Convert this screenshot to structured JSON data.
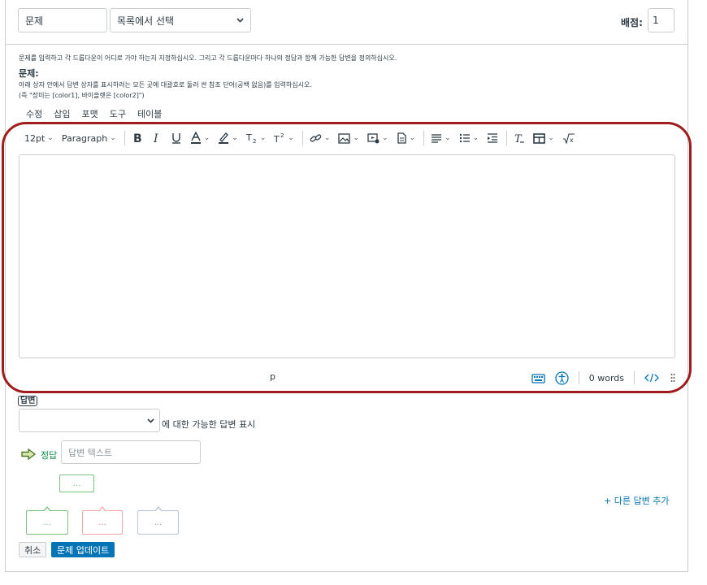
{
  "header": {
    "question_title": "문제",
    "question_type": "목록에서 선택",
    "points_label": "배점:",
    "points_value": "1"
  },
  "instructions": {
    "main": "문제를 입력하고 각 드롭다운이 어디로 가야 하는지 지정하십시오. 그리고 각 드롭다운마다 하나의 정답과 함께 가능한 답변을 정의하십시오.",
    "question_label": "문제:",
    "hint_line1": "아래 상자 안에서 답변 상자를 표시하려는 모든 곳에 대괄호로 둘러 싼 참조 단어(공백 없음)를 입력하십시오.",
    "hint_line2": "(즉 \"장미는 [color1], 바이올렛은 [color2]\")"
  },
  "editor": {
    "menu": [
      "수정",
      "삽입",
      "포맷",
      "도구",
      "테이블"
    ],
    "font_size": "12pt",
    "block_format": "Paragraph",
    "status_path": "p",
    "word_count": "0 words",
    "highlight_color": "#a01c1c"
  },
  "answers": {
    "label": "답변",
    "show_for_label": "에 대한 가능한 답변 표시",
    "correct_label": "정답",
    "answer_placeholder": "답변 텍스트",
    "ellipsis": "...",
    "add_answer": "+ 다른 답변 추가"
  },
  "buttons": {
    "cancel": "취소",
    "update": "문제 업데이트"
  },
  "colors": {
    "accent": "#0374b5",
    "correct": "#0b874b"
  }
}
